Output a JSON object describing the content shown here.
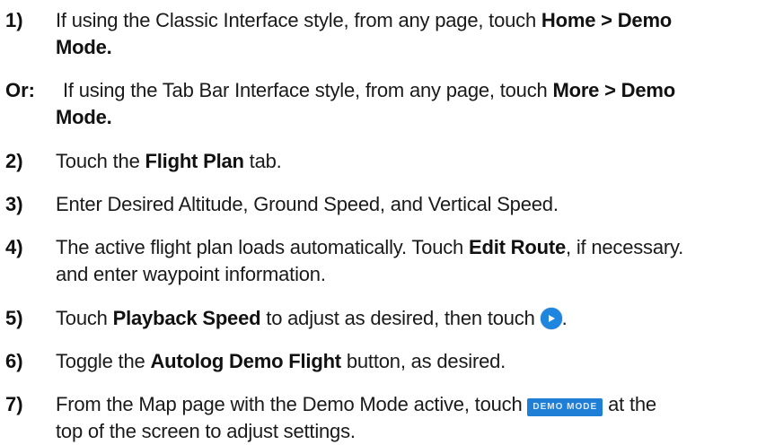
{
  "steps": [
    {
      "number": "1)",
      "t1": "If using the Classic Interface style, from any page, touch ",
      "b1": "Home > Demo",
      "b2": "Mode."
    },
    {
      "number": "Or:",
      "t1": "If using the Tab Bar Interface style, from any page, touch ",
      "b1": "More > Demo",
      "b2": "Mode."
    },
    {
      "number": "2)",
      "t1": "Touch the ",
      "b1": "Flight Plan",
      "t2": " tab."
    },
    {
      "number": "3)",
      "t1": "Enter Desired Altitude, Ground Speed, and Vertical Speed."
    },
    {
      "number": "4)",
      "t1": "The active flight plan loads automatically. Touch ",
      "b1": "Edit Route",
      "t2": ", if necessary.",
      "t3": "and enter waypoint information."
    },
    {
      "number": "5)",
      "t1": "Touch ",
      "b1": "Playback Speed",
      "t2": " to adjust as desired, then touch ",
      "icon": "play-icon",
      "t3": "."
    },
    {
      "number": "6)",
      "t1": "Toggle the ",
      "b1": "Autolog Demo Flight",
      "t2": " button, as desired."
    },
    {
      "number": "7)",
      "t1": "From the Map page with the Demo Mode active, touch ",
      "badge": "DEMO MODE",
      "t2": " at the",
      "t3": "top of the screen to adjust settings."
    }
  ],
  "colors": {
    "button_blue": "#1f86e0",
    "text": "#1a1a1a"
  }
}
